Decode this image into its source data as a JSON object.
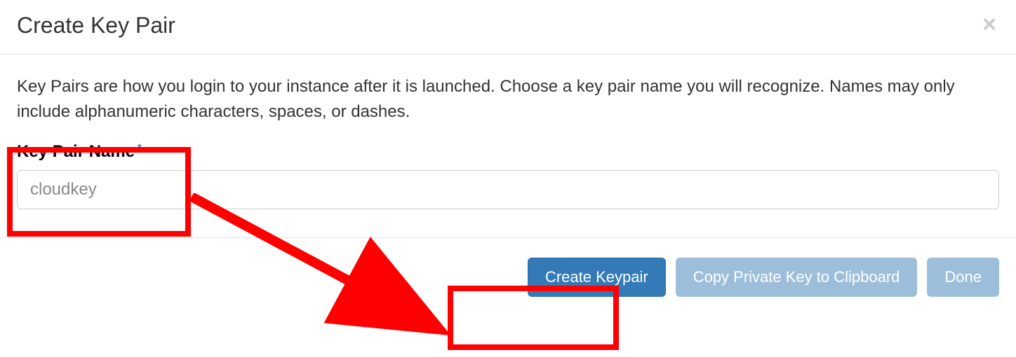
{
  "modal": {
    "title": "Create Key Pair",
    "description": "Key Pairs are how you login to your instance after it is launched. Choose a key pair name you will recognize. Names may only include alphanumeric characters, spaces, or dashes.",
    "field_label": "Key Pair Name",
    "required_mark": "*",
    "input_value": "cloudkey",
    "close_glyph": "×"
  },
  "buttons": {
    "create": "Create Keypair",
    "copy": "Copy Private Key to Clipboard",
    "done": "Done"
  }
}
